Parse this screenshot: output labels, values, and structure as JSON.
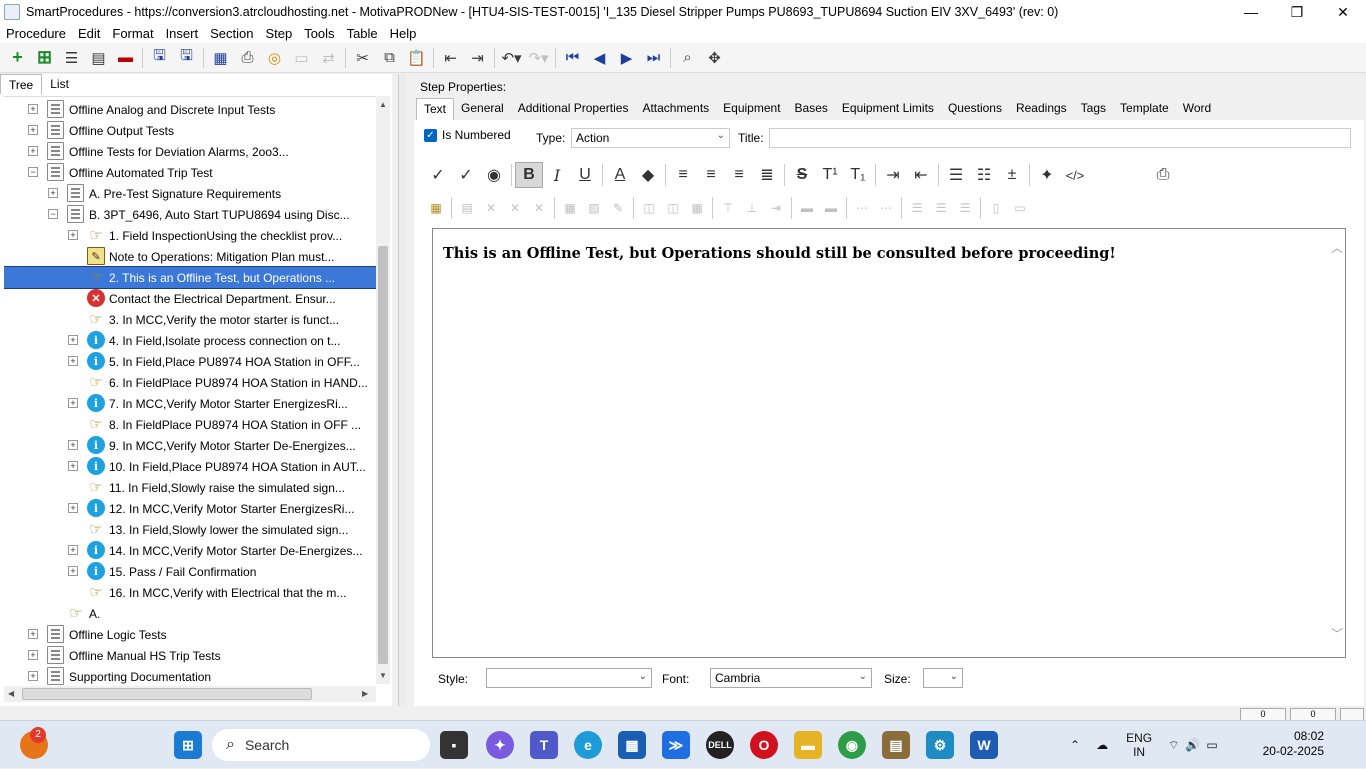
{
  "window": {
    "title": "SmartProcedures - https://conversion3.atrcloudhosting.net - MotivaPRODNew - [HTU4-SIS-TEST-0015] 'I_135 Diesel Stripper Pumps PU8693_TUPU8694 Suction EIV 3XV_6493' (rev: 0)",
    "controls": [
      "—",
      "❐",
      "✕"
    ]
  },
  "menu": [
    "Procedure",
    "Edit",
    "Format",
    "Insert",
    "Section",
    "Step",
    "Tools",
    "Table",
    "Help"
  ],
  "left_tabs": [
    "Tree",
    "List"
  ],
  "tree": [
    {
      "label": "Offline Analog and Discrete Input Tests",
      "icon": "document-icon",
      "expander": "+"
    },
    {
      "label": "Offline Output Tests",
      "icon": "document-icon",
      "expander": "+"
    },
    {
      "label": "Offline Tests for Deviation Alarms, 2oo3...",
      "icon": "document-icon",
      "expander": "+"
    },
    {
      "label": "Offline Automated Trip Test",
      "icon": "document-icon",
      "expander": "−"
    },
    {
      "label": "A. Pre-Test Signature Requirements",
      "icon": "document-icon",
      "expander": "+"
    },
    {
      "label": "B. 3PT_6496, Auto Start TUPU8694 using Disc...",
      "icon": "document-icon",
      "expander": "−"
    },
    {
      "label": "1. Field InspectionUsing the checklist prov...",
      "icon": "hand-icon",
      "expander": "+"
    },
    {
      "label": "Note to Operations: Mitigation Plan must...",
      "icon": "note-icon",
      "expander": ""
    },
    {
      "label": "2. This is an Offline Test, but Operations ...",
      "icon": "hand-icon",
      "expander": "",
      "selected": true
    },
    {
      "label": "Contact the Electrical Department. Ensur...",
      "icon": "error-icon",
      "expander": ""
    },
    {
      "label": "3. In MCC,Verify the motor starter is funct...",
      "icon": "hand-icon",
      "expander": ""
    },
    {
      "label": "4. In Field,Isolate process connection on t...",
      "icon": "info-icon",
      "expander": "+"
    },
    {
      "label": "5. In Field,Place PU8974 HOA Station in OFF...",
      "icon": "info-icon",
      "expander": "+"
    },
    {
      "label": "6. In FieldPlace PU8974 HOA Station in HAND...",
      "icon": "hand-icon",
      "expander": ""
    },
    {
      "label": "7. In MCC,Verify Motor Starter EnergizesRi...",
      "icon": "info-icon",
      "expander": "+"
    },
    {
      "label": "8. In FieldPlace PU8974 HOA Station in OFF ...",
      "icon": "hand-icon",
      "expander": ""
    },
    {
      "label": "9. In MCC,Verify Motor Starter De-Energizes...",
      "icon": "info-icon",
      "expander": "+"
    },
    {
      "label": "10. In Field,Place PU8974 HOA Station in AUT...",
      "icon": "info-icon",
      "expander": "+"
    },
    {
      "label": "11. In Field,Slowly raise the simulated sign...",
      "icon": "hand-icon",
      "expander": ""
    },
    {
      "label": "12. In MCC,Verify Motor Starter EnergizesRi...",
      "icon": "info-icon",
      "expander": "+"
    },
    {
      "label": "13. In Field,Slowly lower the simulated sign...",
      "icon": "hand-icon",
      "expander": ""
    },
    {
      "label": "14. In MCC,Verify Motor Starter De-Energizes...",
      "icon": "info-icon",
      "expander": "+"
    },
    {
      "label": "15. Pass / Fail Confirmation",
      "icon": "info-icon",
      "expander": "+"
    },
    {
      "label": "16. In MCC,Verify with Electrical that the m...",
      "icon": "hand-icon",
      "expander": ""
    },
    {
      "label": "A.",
      "icon": "hand-icon",
      "expander": ""
    },
    {
      "label": "Offline Logic Tests",
      "icon": "document-icon",
      "expander": "+"
    },
    {
      "label": "Offline Manual HS Trip Tests",
      "icon": "document-icon",
      "expander": "+"
    },
    {
      "label": "Supporting Documentation",
      "icon": "document-icon",
      "expander": "+"
    }
  ],
  "step_properties": {
    "heading": "Step Properties:",
    "tabs": [
      "Text",
      "General",
      "Additional Properties",
      "Attachments",
      "Equipment",
      "Bases",
      "Equipment Limits",
      "Questions",
      "Readings",
      "Tags",
      "Template",
      "Word"
    ],
    "is_numbered_label": "Is Numbered",
    "is_numbered": true,
    "type_label": "Type:",
    "type_value": "Action",
    "title_label": "Title:",
    "title_value": "",
    "editor_text": "This is an Offline Test, but Operations should still be consulted before proceeding!",
    "style_label": "Style:",
    "style_value": "",
    "font_label": "Font:",
    "font_value": "Cambria",
    "size_label": "Size:",
    "size_value": ""
  },
  "status": {
    "box1": "0",
    "box2": "0"
  },
  "taskbar": {
    "search_placeholder": "Search",
    "notification_count": "2",
    "lang_line1": "ENG",
    "lang_line2": "IN",
    "time": "08:02",
    "date": "20-02-2025"
  },
  "colors": {
    "selection": "#3c78d8",
    "accent": "#0067c0"
  }
}
